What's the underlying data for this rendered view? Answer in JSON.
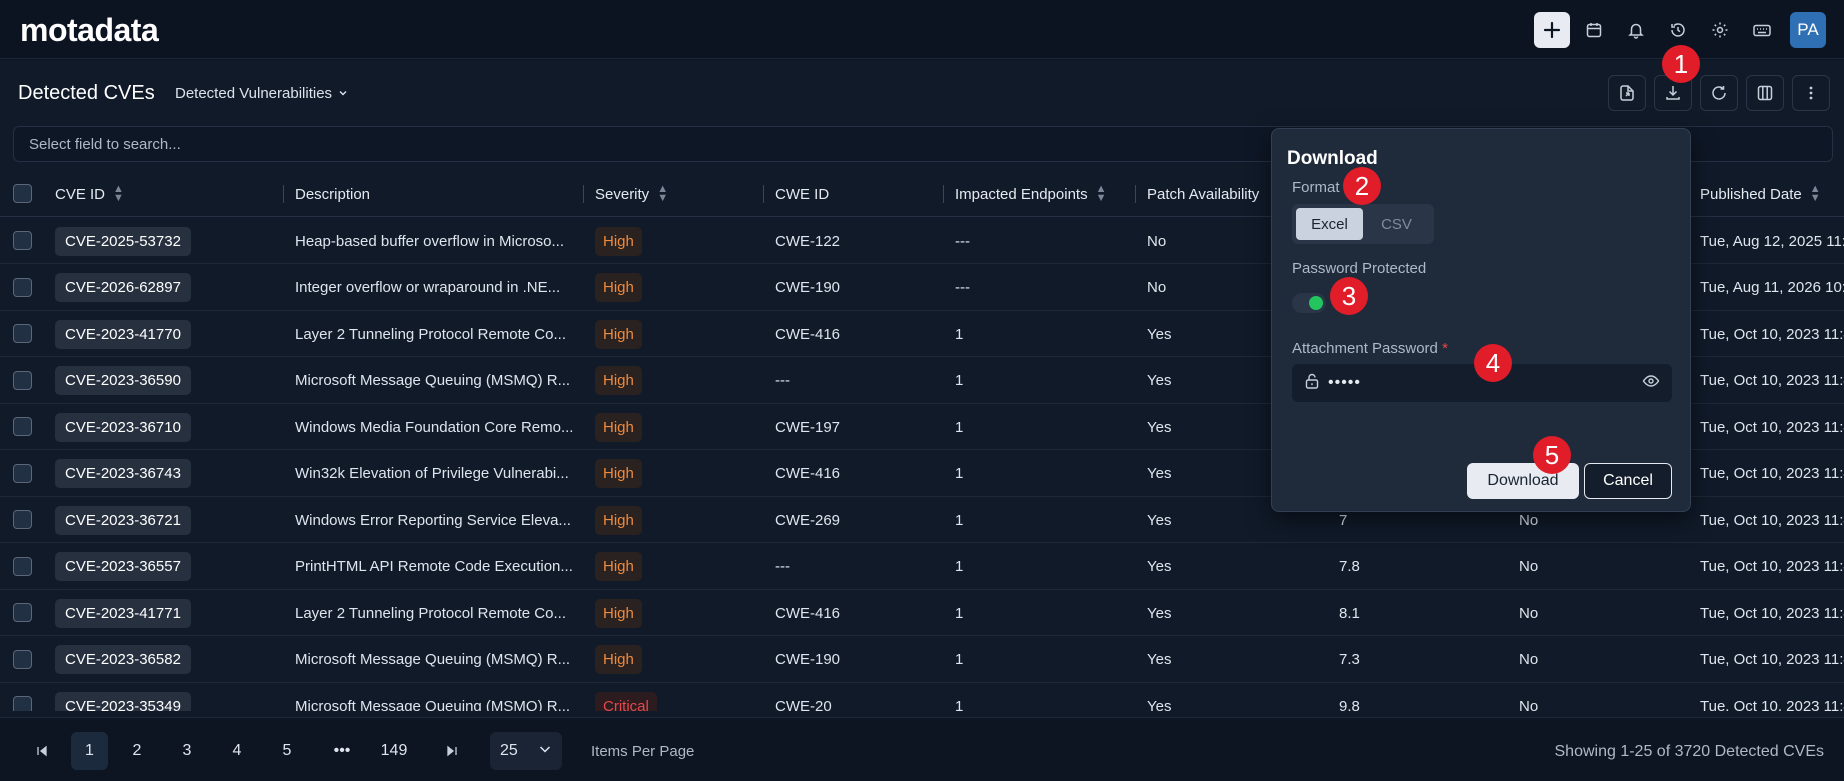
{
  "app": {
    "logo": "motadata",
    "user_initials": "PA"
  },
  "topbar": {
    "icons": [
      "plus-icon",
      "calendar-icon",
      "bell-icon",
      "history-icon",
      "gear-icon",
      "keyboard-icon"
    ]
  },
  "page": {
    "title": "Detected CVEs",
    "view": "Detected Vulnerabilities"
  },
  "search": {
    "placeholder": "Select field to search..."
  },
  "table": {
    "headers": [
      "CVE ID",
      "Description",
      "Severity",
      "CWE ID",
      "Impacted Endpoints",
      "Patch Availability",
      "Published Date"
    ],
    "rows": [
      {
        "cve": "CVE-2025-53732",
        "desc": "Heap-based buffer overflow in Microso...",
        "sev": "High",
        "cwe": "CWE-122",
        "ep": "---",
        "patch": "No",
        "score": "",
        "exploit": "",
        "date": "Tue, Aug 12, 2025 11:"
      },
      {
        "cve": "CVE-2026-62897",
        "desc": "Integer overflow or wraparound in .NE...",
        "sev": "High",
        "cwe": "CWE-190",
        "ep": "---",
        "patch": "No",
        "score": "",
        "exploit": "",
        "date": "Tue, Aug 11, 2026 10:"
      },
      {
        "cve": "CVE-2023-41770",
        "desc": "Layer 2 Tunneling Protocol Remote Co...",
        "sev": "High",
        "cwe": "CWE-416",
        "ep": "1",
        "patch": "Yes",
        "score": "",
        "exploit": "",
        "date": "Tue, Oct 10, 2023 11:4"
      },
      {
        "cve": "CVE-2023-36590",
        "desc": "Microsoft Message Queuing (MSMQ) R...",
        "sev": "High",
        "cwe": "---",
        "ep": "1",
        "patch": "Yes",
        "score": "",
        "exploit": "",
        "date": "Tue, Oct 10, 2023 11:4"
      },
      {
        "cve": "CVE-2023-36710",
        "desc": "Windows Media Foundation Core Remo...",
        "sev": "High",
        "cwe": "CWE-197",
        "ep": "1",
        "patch": "Yes",
        "score": "",
        "exploit": "",
        "date": "Tue, Oct 10, 2023 11:4"
      },
      {
        "cve": "CVE-2023-36743",
        "desc": "Win32k Elevation of Privilege Vulnerabi...",
        "sev": "High",
        "cwe": "CWE-416",
        "ep": "1",
        "patch": "Yes",
        "score": "",
        "exploit": "",
        "date": "Tue, Oct 10, 2023 11:4"
      },
      {
        "cve": "CVE-2023-36721",
        "desc": "Windows Error Reporting Service Eleva...",
        "sev": "High",
        "cwe": "CWE-269",
        "ep": "1",
        "patch": "Yes",
        "score": "7",
        "exploit": "No",
        "date": "Tue, Oct 10, 2023 11:4"
      },
      {
        "cve": "CVE-2023-36557",
        "desc": "PrintHTML API Remote Code Execution...",
        "sev": "High",
        "cwe": "---",
        "ep": "1",
        "patch": "Yes",
        "score": "7.8",
        "exploit": "No",
        "date": "Tue, Oct 10, 2023 11:4"
      },
      {
        "cve": "CVE-2023-41771",
        "desc": "Layer 2 Tunneling Protocol Remote Co...",
        "sev": "High",
        "cwe": "CWE-416",
        "ep": "1",
        "patch": "Yes",
        "score": "8.1",
        "exploit": "No",
        "date": "Tue, Oct 10, 2023 11:4"
      },
      {
        "cve": "CVE-2023-36582",
        "desc": "Microsoft Message Queuing (MSMQ) R...",
        "sev": "High",
        "cwe": "CWE-190",
        "ep": "1",
        "patch": "Yes",
        "score": "7.3",
        "exploit": "No",
        "date": "Tue, Oct 10, 2023 11:4"
      },
      {
        "cve": "CVE-2023-35349",
        "desc": "Microsoft Message Queuing (MSMQ) R...",
        "sev": "Critical",
        "cwe": "CWE-20",
        "ep": "1",
        "patch": "Yes",
        "score": "9.8",
        "exploit": "No",
        "date": "Tue, Oct 10, 2023 11:4"
      }
    ]
  },
  "pagination": {
    "pages": [
      "1",
      "2",
      "3",
      "4",
      "5",
      "149"
    ],
    "ellipsis": "•••",
    "per_page": "25",
    "per_page_label": "Items Per Page",
    "showing": "Showing 1-25 of 3720 Detected CVEs"
  },
  "modal": {
    "title": "Download",
    "format_label": "Format",
    "format_options": [
      "Excel",
      "CSV"
    ],
    "format_selected": "Excel",
    "password_protected_label": "Password Protected",
    "password_protected": true,
    "attachment_password_label": "Attachment Password",
    "required_mark": "*",
    "password_value": "•••••",
    "download_button": "Download",
    "cancel_button": "Cancel"
  },
  "badges": [
    "1",
    "2",
    "3",
    "4",
    "5"
  ],
  "colors": {
    "accent_high": "#f08a3c",
    "accent_critical": "#e5484d",
    "badge": "#e11d2a",
    "toggle_on": "#22c55e"
  }
}
